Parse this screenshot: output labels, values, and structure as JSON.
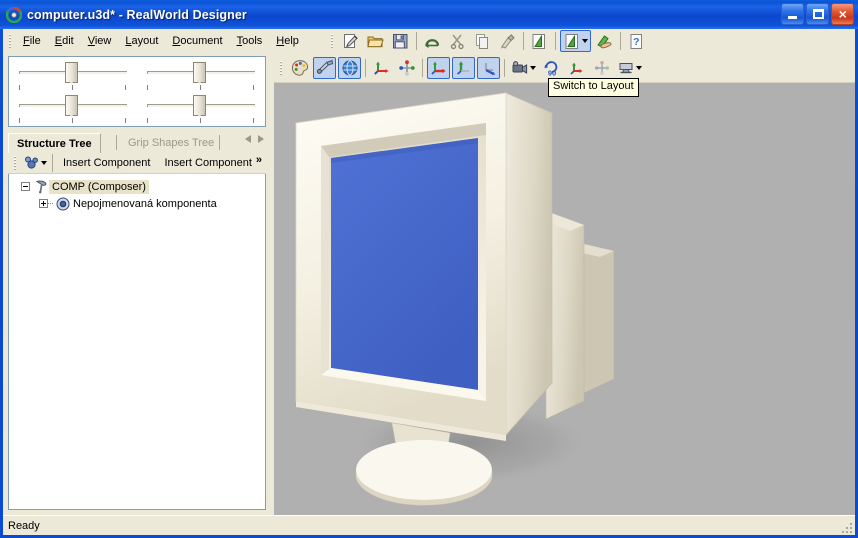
{
  "window": {
    "title": "computer.u3d* - RealWorld Designer",
    "app_icon": "realworld-logo-icon",
    "buttons": {
      "minimize": "minimize-icon",
      "maximize": "maximize-icon",
      "close": "×"
    }
  },
  "menu": {
    "items": [
      {
        "label": "File",
        "mnemonic": "F"
      },
      {
        "label": "Edit",
        "mnemonic": "E"
      },
      {
        "label": "View",
        "mnemonic": "V"
      },
      {
        "label": "Layout",
        "mnemonic": "L"
      },
      {
        "label": "Document",
        "mnemonic": "D"
      },
      {
        "label": "Tools",
        "mnemonic": "T"
      },
      {
        "label": "Help",
        "mnemonic": "H"
      }
    ]
  },
  "main_toolbar": {
    "buttons": [
      {
        "icon": "new-document-icon",
        "name": "new-button"
      },
      {
        "icon": "open-folder-icon",
        "name": "open-button"
      },
      {
        "icon": "save-floppy-icon",
        "name": "save-button"
      },
      {
        "icon": "undo-arc-icon",
        "name": "undo-button"
      },
      {
        "icon": "cut-scissors-icon",
        "name": "cut-button"
      },
      {
        "icon": "copy-pages-icon",
        "name": "copy-button"
      },
      {
        "icon": "paste-brush-icon",
        "name": "paste-button"
      },
      {
        "icon": "export-green-icon",
        "name": "export-button"
      },
      {
        "icon": "layout-green-dropdown-icon",
        "name": "layout-dropdown-button"
      },
      {
        "icon": "hand-apply-icon",
        "name": "apply-button"
      },
      {
        "icon": "help-question-icon",
        "name": "help-button"
      }
    ]
  },
  "left_panel": {
    "sliders": [
      {
        "name": "slider-top-left",
        "value": 50
      },
      {
        "name": "slider-top-right",
        "value": 50
      },
      {
        "name": "slider-bottom-left",
        "value": 50
      },
      {
        "name": "slider-bottom-right",
        "value": 50
      }
    ],
    "tabs": [
      {
        "label": "Structure Tree",
        "active": true
      },
      {
        "label": "Grip Shapes Tree",
        "active": false
      }
    ],
    "tab_nav": {
      "prev": "chevron-left-icon",
      "next": "chevron-right-icon"
    },
    "tree_toolbar": {
      "node_icon": "blue-node-dropdown-icon",
      "insert_component_1": "Insert Component",
      "insert_component_2": "Insert Component",
      "overflow": "»"
    },
    "tree": {
      "root": {
        "label": "COMP (Composer)",
        "icon": "composer-icon",
        "expanded": true,
        "selected": true
      },
      "children": [
        {
          "label": "Nepojmenovaná komponenta",
          "icon": "component-sphere-icon",
          "expanded": false,
          "selected": false
        }
      ]
    }
  },
  "view_toolbar": {
    "buttons": [
      {
        "icon": "palette-icon",
        "name": "materials-button",
        "pressed": false
      },
      {
        "icon": "flashlight-icon",
        "name": "lighting-button",
        "pressed": true
      },
      {
        "icon": "globe-icon",
        "name": "environment-button",
        "pressed": true
      },
      {
        "icon": "axis-move-icon",
        "name": "move-gizmo-button",
        "pressed": false
      },
      {
        "icon": "axis-point-icon",
        "name": "pivot-gizmo-button",
        "pressed": false
      },
      {
        "icon": "axis-x-icon",
        "name": "axis-x-button",
        "pressed": true
      },
      {
        "icon": "axis-y-icon",
        "name": "axis-y-button",
        "pressed": true
      },
      {
        "icon": "axis-z-icon",
        "name": "axis-z-button",
        "pressed": true
      },
      {
        "icon": "camera-dropdown-icon",
        "name": "camera-button",
        "pressed": false
      },
      {
        "icon": "rotate-90-icon",
        "name": "rotate-90-button",
        "pressed": false
      },
      {
        "icon": "axis-gizmo-small-icon",
        "name": "gizmo-button",
        "pressed": false
      },
      {
        "icon": "pivot-small-icon",
        "name": "pivot-button",
        "pressed": false
      },
      {
        "icon": "monitor-dropdown-icon",
        "name": "view-preset-button",
        "pressed": false
      }
    ]
  },
  "tooltip": {
    "text": "Switch to Layout"
  },
  "viewport": {
    "background_color": "#b0b0b0",
    "model": {
      "name": "crt-monitor-3d-model",
      "body_color": "#f0ece0",
      "screen_color": "#4a6fd0",
      "shadow_color": "#8f8f8f"
    }
  },
  "status_bar": {
    "text": "Ready"
  }
}
